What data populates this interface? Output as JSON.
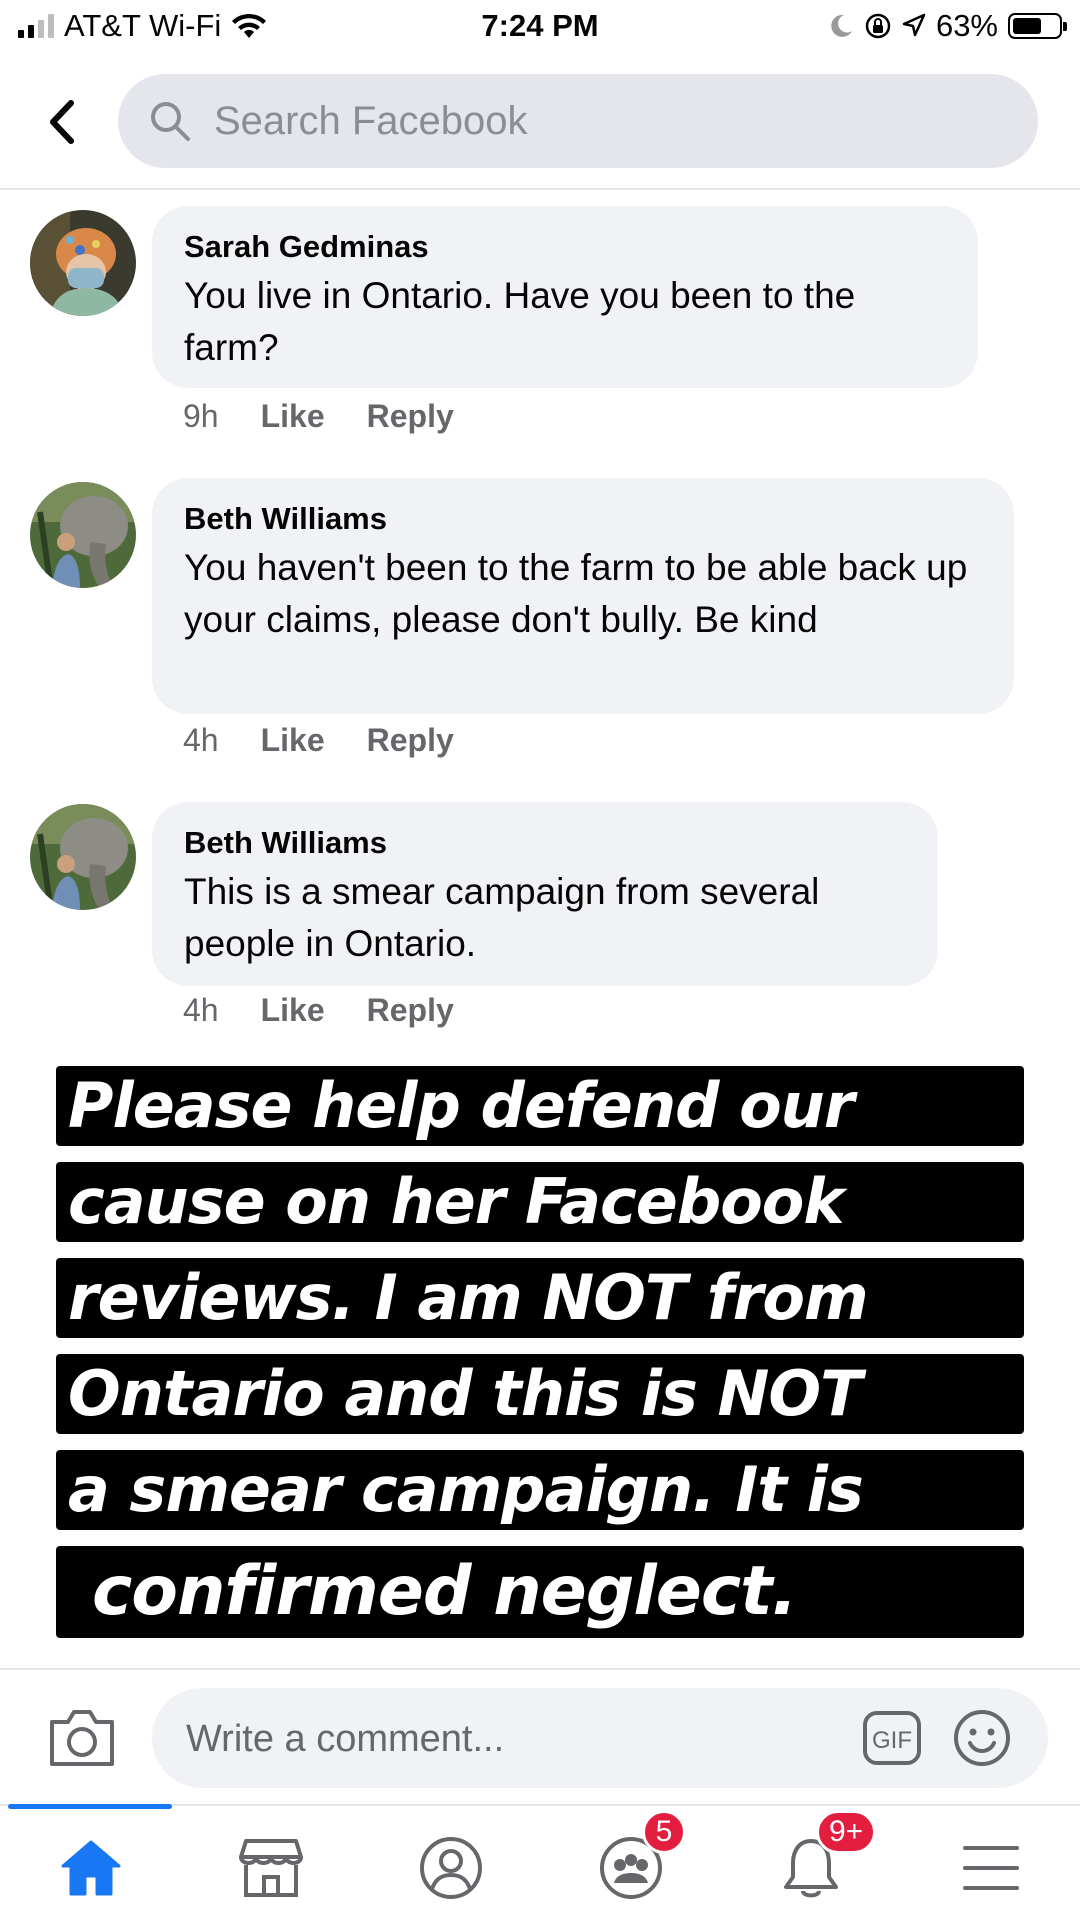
{
  "status_bar": {
    "carrier": "AT&T Wi-Fi",
    "time": "7:24 PM",
    "battery_percent": "63%",
    "battery_level": 0.63
  },
  "header": {
    "search_placeholder": "Search Facebook"
  },
  "comments": [
    {
      "author": "Sarah Gedminas",
      "text": "You live in Ontario. Have you been to the farm?",
      "time": "9h",
      "like": "Like",
      "reply": "Reply"
    },
    {
      "author": "Beth Williams",
      "text": "You haven't been to the farm to be able back up your claims, please don't bully. Be kind",
      "time": "4h",
      "like": "Like",
      "reply": "Reply"
    },
    {
      "author": "Beth Williams",
      "text": "This is a smear campaign from several people in Ontario.",
      "time": "4h",
      "like": "Like",
      "reply": "Reply"
    }
  ],
  "caption": {
    "lines": [
      "Please help defend our",
      "cause on her Facebook",
      "reviews. I am NOT from",
      "Ontario and this is NOT",
      "a smear campaign. It is",
      "confirmed neglect."
    ]
  },
  "composer": {
    "placeholder": "Write a comment...",
    "gif_label": "GIF"
  },
  "bottom_nav": {
    "groups_badge": "5",
    "notifications_badge": "9+",
    "accent_color": "#1877f2"
  }
}
